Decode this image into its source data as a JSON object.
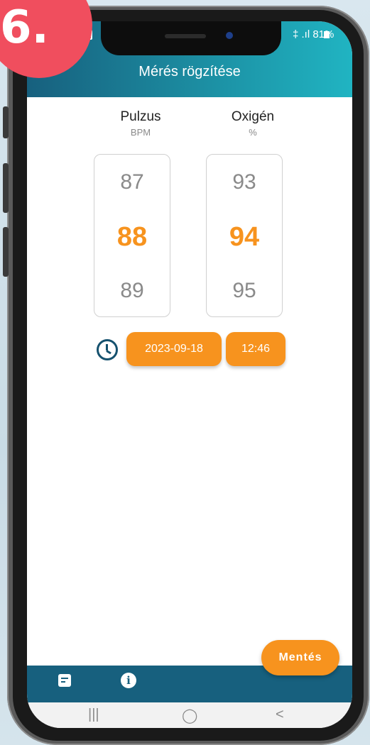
{
  "badge": {
    "text": "6."
  },
  "status_bar": {
    "signal_battery": "‡ .ıl 81%"
  },
  "header": {
    "title": "Mérés rögzítése"
  },
  "columns": [
    {
      "label": "Pulzus",
      "unit": "BPM",
      "prev": "87",
      "current": "88",
      "next": "89"
    },
    {
      "label": "Oxigén",
      "unit": "%",
      "prev": "93",
      "current": "94",
      "next": "95"
    }
  ],
  "datetime": {
    "date": "2023-09-18",
    "time": "12:46"
  },
  "actions": {
    "save_label": "Mentés"
  },
  "icons": {
    "back": "arrow-left-icon",
    "clock": "clock-icon",
    "note": "note-icon",
    "info": "info-icon"
  },
  "navbar": {
    "recent": "|||",
    "home": "◯",
    "back": "<"
  },
  "colors": {
    "accent": "#f7931e",
    "header_start": "#17607e",
    "header_end": "#20b4c2",
    "badge": "#f04e5e"
  }
}
